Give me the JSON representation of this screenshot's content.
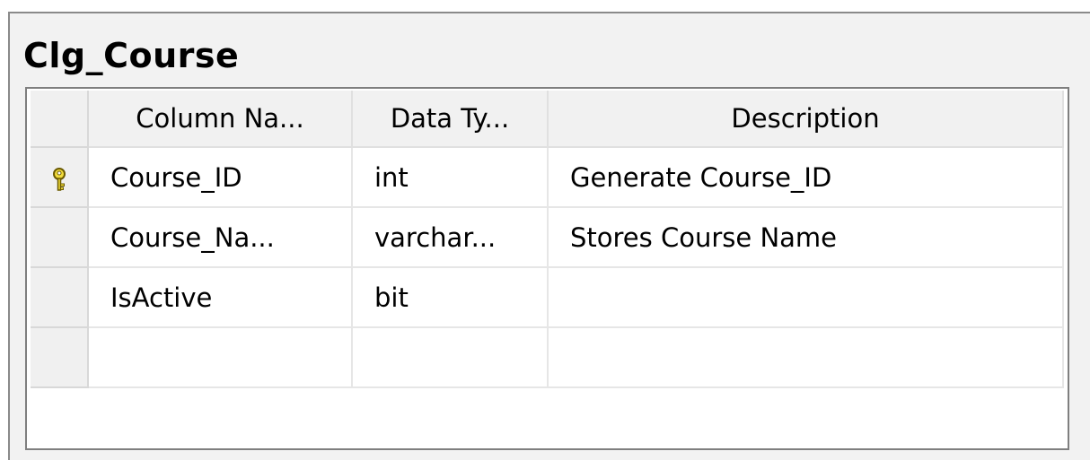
{
  "table": {
    "title": "Clg_Course",
    "columns": [
      "Column Na...",
      "Data Ty...",
      "Description"
    ],
    "rows": [
      {
        "primary_key": true,
        "icon": "key-icon",
        "name": "Course_ID",
        "type": "int",
        "description": "Generate Course_ID"
      },
      {
        "primary_key": false,
        "name": "Course_Na...",
        "type": "varchar...",
        "description": "Stores Course Name"
      },
      {
        "primary_key": false,
        "name": "IsActive",
        "type": "bit",
        "description": ""
      },
      {
        "primary_key": false,
        "name": "",
        "type": "",
        "description": ""
      }
    ]
  },
  "colors": {
    "key_icon": "#f2dc3c",
    "key_outline": "#6b5a00"
  }
}
